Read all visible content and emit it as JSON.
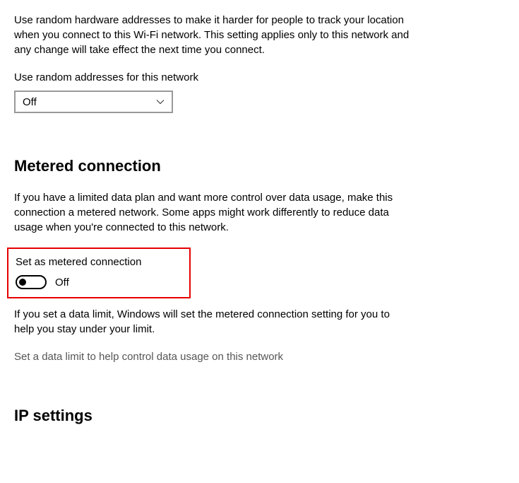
{
  "random_addresses": {
    "description": "Use random hardware addresses to make it harder for people to track your location when you connect to this Wi-Fi network. This setting applies only to this network and any change will take effect the next time you connect.",
    "label": "Use random addresses for this network",
    "dropdown_value": "Off"
  },
  "metered": {
    "heading": "Metered connection",
    "description": "If you have a limited data plan and want more control over data usage, make this connection a metered network. Some apps might work differently to reduce data usage when you're connected to this network.",
    "toggle_label": "Set as metered connection",
    "toggle_state": "Off",
    "data_limit_description": "If you set a data limit, Windows will set the metered connection setting for you to help you stay under your limit.",
    "data_limit_link": "Set a data limit to help control data usage on this network"
  },
  "ip": {
    "heading": "IP settings"
  }
}
